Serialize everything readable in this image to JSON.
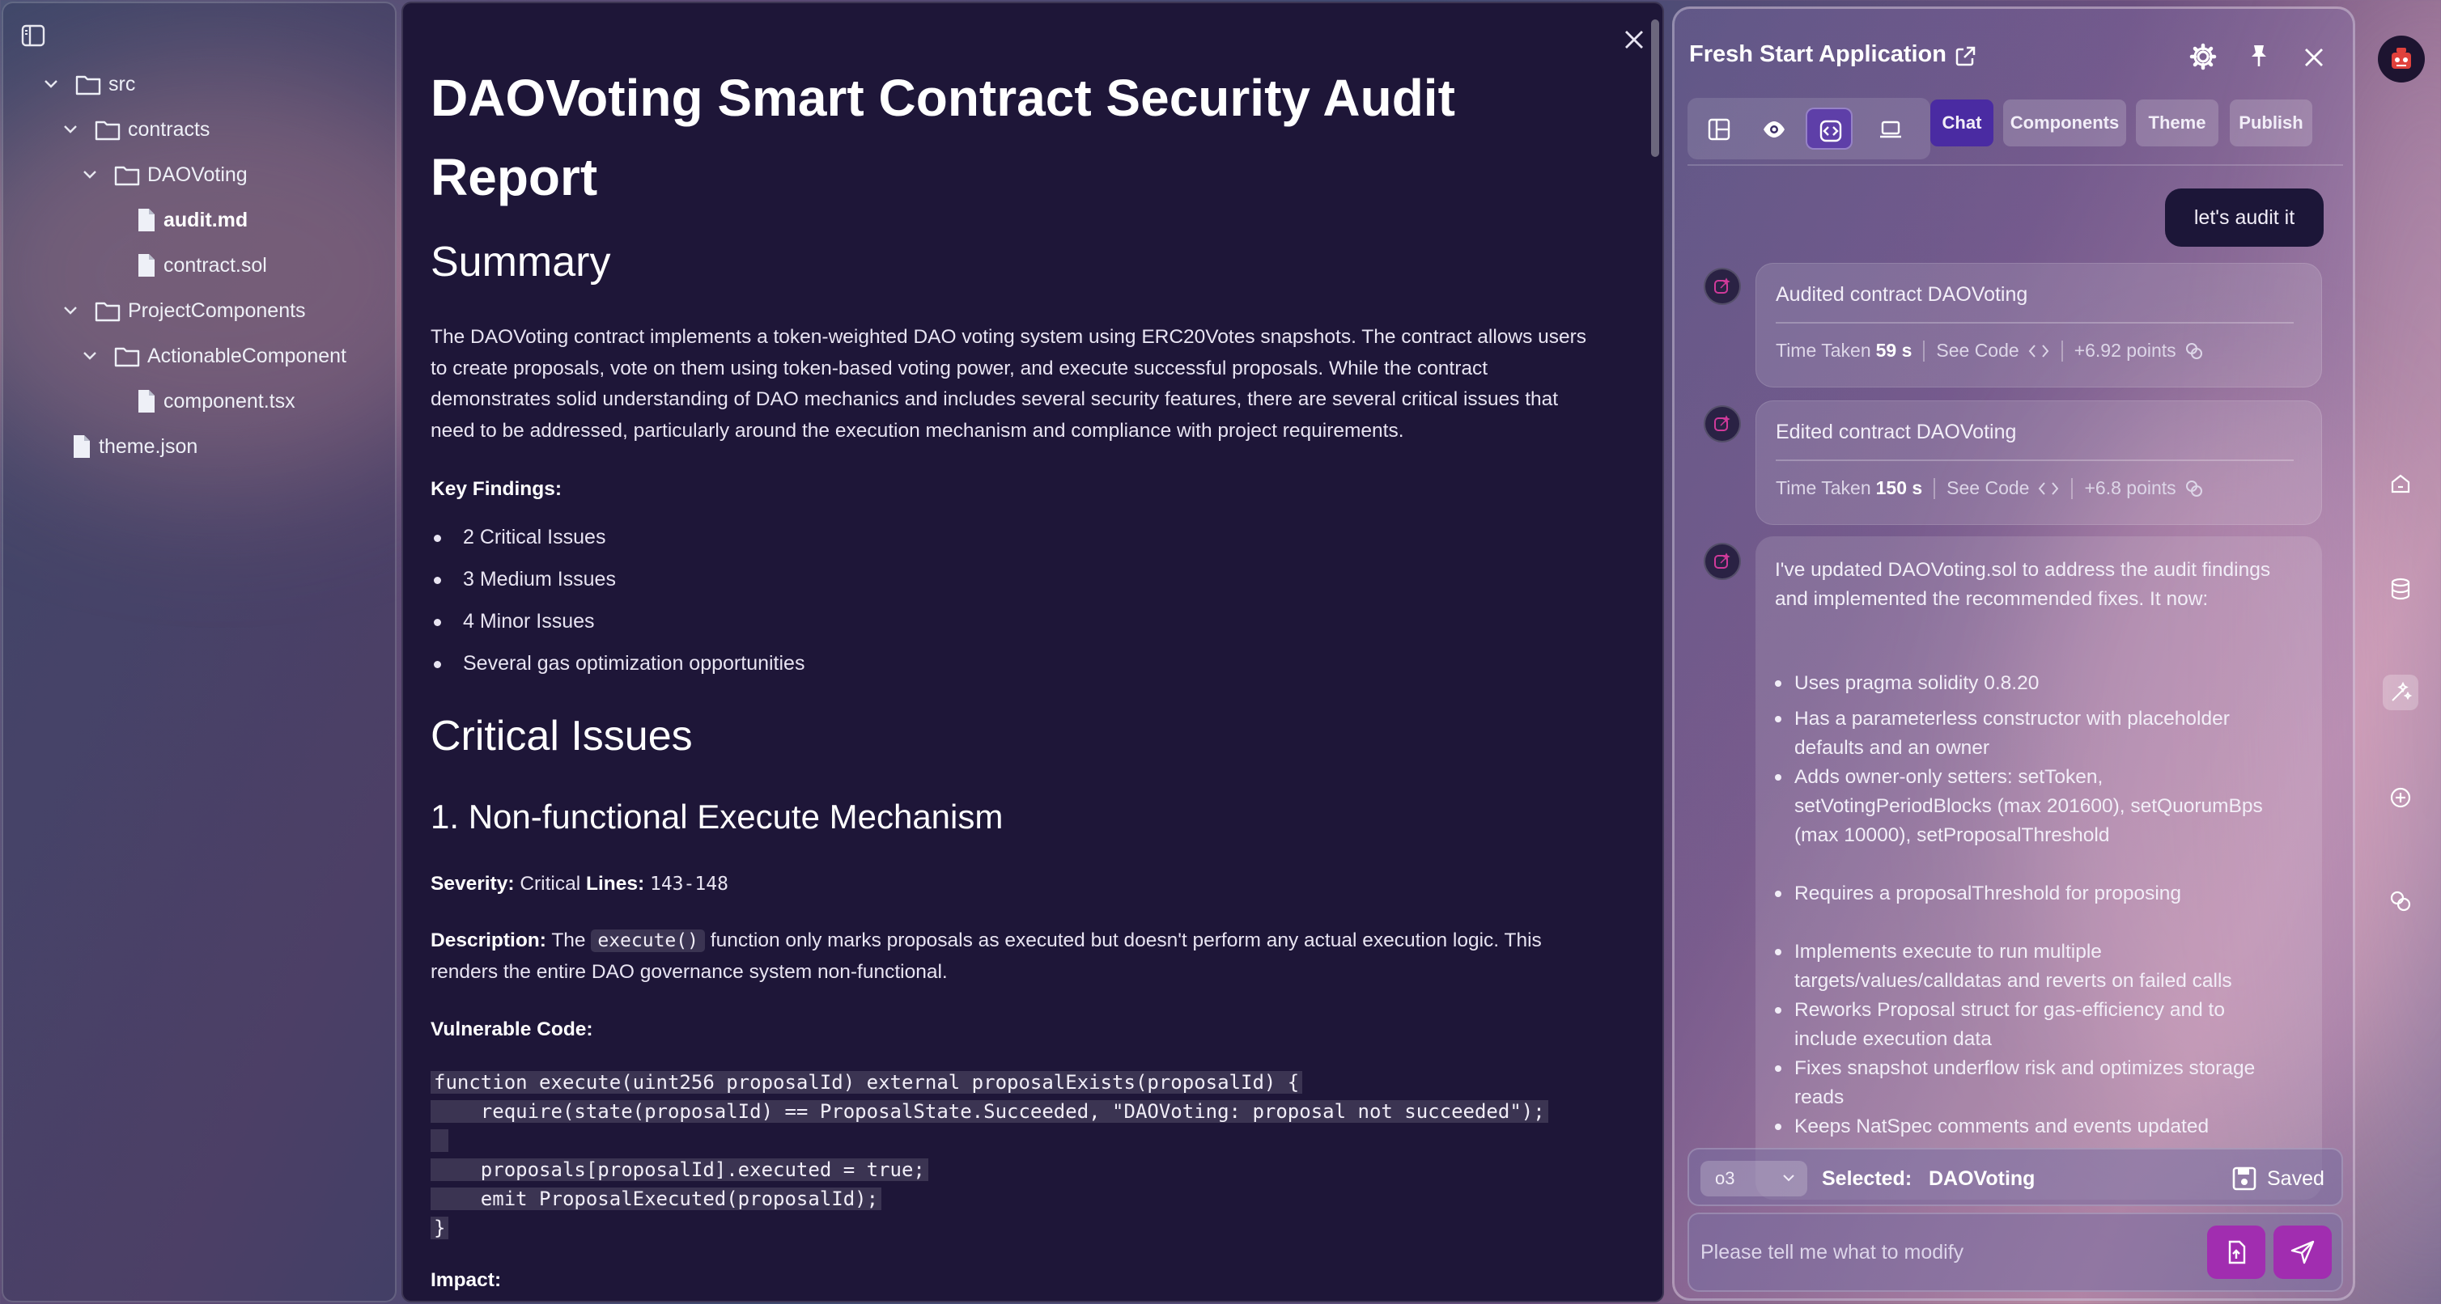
{
  "sidebar": {
    "tree": [
      {
        "label": "src",
        "type": "folder",
        "depth": 0,
        "expanded": true
      },
      {
        "label": "contracts",
        "type": "folder",
        "depth": 1,
        "expanded": true
      },
      {
        "label": "DAOVoting",
        "type": "folder",
        "depth": 2,
        "expanded": true
      },
      {
        "label": "audit.md",
        "type": "file",
        "depth": 3,
        "active": true
      },
      {
        "label": "contract.sol",
        "type": "file",
        "depth": 3
      },
      {
        "label": "ProjectComponents",
        "type": "folder",
        "depth": 1,
        "expanded": true
      },
      {
        "label": "ActionableComponent",
        "type": "folder",
        "depth": 2,
        "expanded": true
      },
      {
        "label": "component.tsx",
        "type": "file",
        "depth": 3
      },
      {
        "label": "theme.json",
        "type": "file",
        "depth": 0
      }
    ]
  },
  "document": {
    "title": "DAOVoting Smart Contract Security Audit Report",
    "summary_heading": "Summary",
    "summary_text": "The DAOVoting contract implements a token-weighted DAO voting system using ERC20Votes snapshots. The contract allows users to create proposals, vote on them using token-based voting power, and execute successful proposals. While the contract demonstrates solid understanding of DAO mechanics and includes several security features, there are several critical issues that need to be addressed, particularly around the execution mechanism and compliance with project requirements.",
    "key_findings_label": "Key Findings:",
    "key_findings": [
      "2 Critical Issues",
      "3 Medium Issues",
      "4 Minor Issues",
      "Several gas optimization opportunities"
    ],
    "critical_heading": "Critical Issues",
    "issue1_heading": "1. Non-functional Execute Mechanism",
    "severity_label": "Severity:",
    "severity_value": "Critical",
    "lines_label": "Lines:",
    "lines_value": "143-148",
    "description_label": "Description:",
    "description_pre": "The",
    "description_code": "execute()",
    "description_post": "function only marks proposals as executed but doesn't perform any actual execution logic. This renders the entire DAO governance system non-functional.",
    "vulnerable_label": "Vulnerable Code:",
    "code_lines": [
      "function execute(uint256 proposalId) external proposalExists(proposalId) {",
      "    require(state(proposalId) == ProposalState.Succeeded, \"DAOVoting: proposal not succeeded\");",
      " ",
      "    proposals[proposalId].executed = true;",
      "    emit ProposalExecuted(proposalId);",
      "}"
    ],
    "impact_label": "Impact:"
  },
  "panel": {
    "title": "Fresh Start Application",
    "tabs": [
      "Chat",
      "Components",
      "Theme",
      "Publish"
    ],
    "active_tab": "Chat",
    "user_message": "let's audit it",
    "card1": {
      "title": "Audited contract DAOVoting",
      "time_label": "Time Taken",
      "time_value": "59 s",
      "see_code": "See Code",
      "points": "+6.92 points"
    },
    "card2": {
      "title": "Edited contract DAOVoting",
      "time_label": "Time Taken",
      "time_value": "150 s",
      "see_code": "See Code",
      "points": "+6.8 points"
    },
    "message_intro": "I've updated DAOVoting.sol to address the audit findings and implemented the recommended fixes. It now:",
    "message_items": [
      "Uses pragma solidity 0.8.20",
      "Has a parameterless constructor with placeholder defaults and an owner",
      "Adds owner-only setters: setToken, setVotingPeriodBlocks (max 201600), setQuorumBps (max 10000), setProposalThreshold",
      "Requires a proposalThreshold for proposing",
      "Implements execute to run multiple targets/values/calldatas and reverts on failed calls",
      "Reworks Proposal struct for gas-efficiency and to include execution data",
      "Fixes snapshot underflow risk and optimizes storage reads",
      "Keeps NatSpec comments and events updated"
    ],
    "model": "o3",
    "selected_label": "Selected:",
    "selected_value": "DAOVoting",
    "saved_label": "Saved",
    "input_placeholder": "Please tell me what to modify"
  },
  "colors": {
    "accent": "#4a2ba2",
    "send": "#a12db0",
    "doc_bg": "#1e1638"
  }
}
